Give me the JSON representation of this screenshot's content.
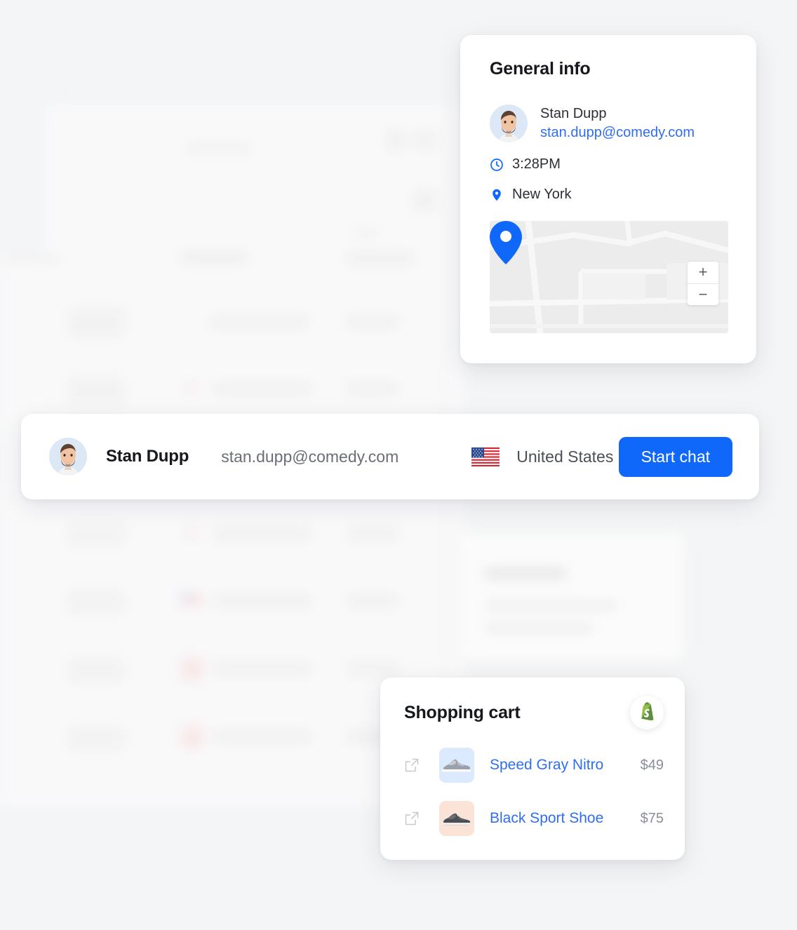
{
  "background": {
    "page_color": "#f4f5f6",
    "description": "blurred placeholder table UI"
  },
  "general_info": {
    "title": "General info",
    "person": {
      "avatar_alt": "user-photo",
      "name": "Stan Dupp",
      "email": "stan.dupp@comedy.com"
    },
    "time": {
      "icon": "clock-icon",
      "value": "3:28PM"
    },
    "location": {
      "icon": "map-pin-icon",
      "value": "New York"
    },
    "map": {
      "pin_color": "#1068fb",
      "zoom_in": "+",
      "zoom_out": "−"
    }
  },
  "contact_bar": {
    "avatar_alt": "user-photo",
    "name": "Stan Dupp",
    "email": "stan.dupp@comedy.com",
    "flag": "united-states-flag-icon",
    "country": "United States",
    "action_label": "Start chat",
    "action_color": "#1068fb"
  },
  "shopping_cart": {
    "title": "Shopping cart",
    "provider_icon": "shopify-bag-icon",
    "items": [
      {
        "open_icon": "external-link-icon",
        "thumb": "gray-sneaker-thumbnail",
        "thumb_bg": "#dbeafe",
        "name": "Speed Gray Nitro",
        "price": "$49"
      },
      {
        "open_icon": "external-link-icon",
        "thumb": "black-sneaker-thumbnail",
        "thumb_bg": "#fbe3d8",
        "name": "Black Sport Shoe",
        "price": "$75"
      }
    ]
  }
}
